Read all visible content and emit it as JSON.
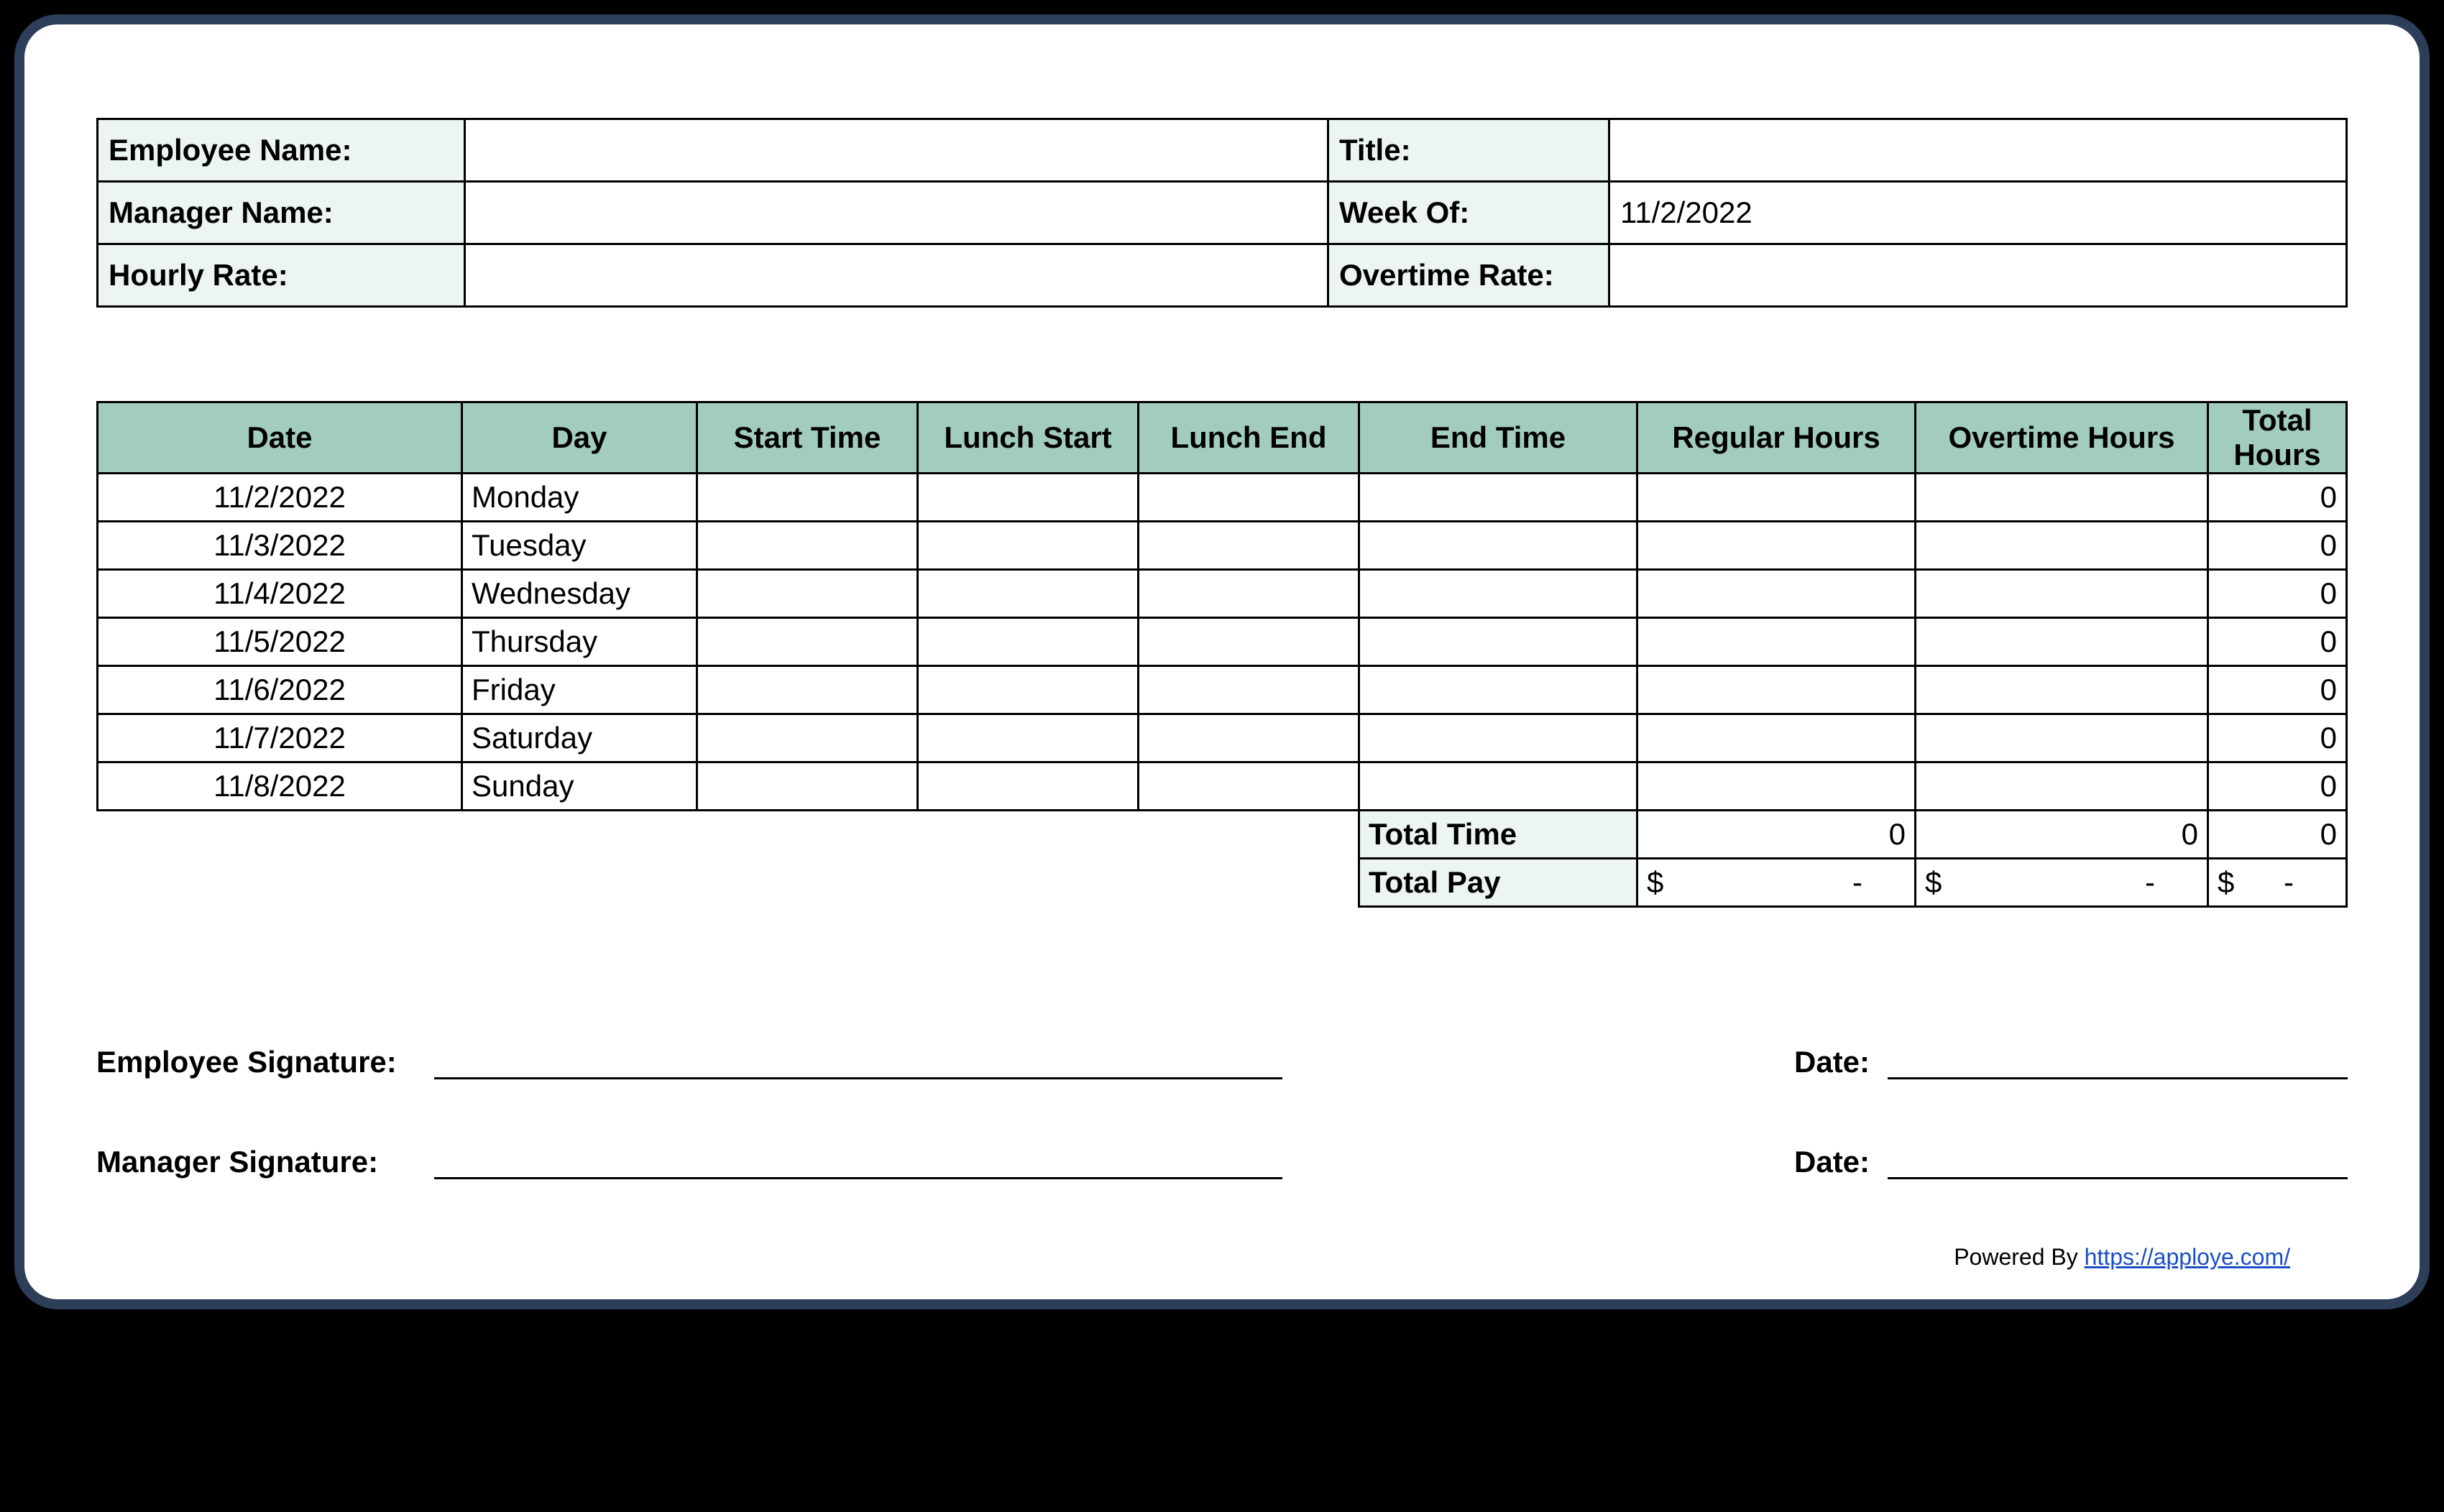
{
  "info": {
    "employee_name_label": "Employee Name:",
    "employee_name_value": "",
    "title_label": "Title:",
    "title_value": "",
    "manager_name_label": "Manager Name:",
    "manager_name_value": "",
    "week_of_label": "Week Of:",
    "week_of_value": "11/2/2022",
    "hourly_rate_label": "Hourly Rate:",
    "hourly_rate_value": "",
    "overtime_rate_label": "Overtime Rate:",
    "overtime_rate_value": ""
  },
  "headers": {
    "date": "Date",
    "day": "Day",
    "start_time": "Start Time",
    "lunch_start": "Lunch Start",
    "lunch_end": "Lunch End",
    "end_time": "End Time",
    "regular_hours": "Regular Hours",
    "overtime_hours": "Overtime Hours",
    "total_hours": "Total Hours"
  },
  "rows": [
    {
      "date": "11/2/2022",
      "day": "Monday",
      "start": "",
      "lstart": "",
      "lend": "",
      "end": "",
      "reg": "",
      "ot": "",
      "total": "0"
    },
    {
      "date": "11/3/2022",
      "day": "Tuesday",
      "start": "",
      "lstart": "",
      "lend": "",
      "end": "",
      "reg": "",
      "ot": "",
      "total": "0"
    },
    {
      "date": "11/4/2022",
      "day": "Wednesday",
      "start": "",
      "lstart": "",
      "lend": "",
      "end": "",
      "reg": "",
      "ot": "",
      "total": "0"
    },
    {
      "date": "11/5/2022",
      "day": "Thursday",
      "start": "",
      "lstart": "",
      "lend": "",
      "end": "",
      "reg": "",
      "ot": "",
      "total": "0"
    },
    {
      "date": "11/6/2022",
      "day": "Friday",
      "start": "",
      "lstart": "",
      "lend": "",
      "end": "",
      "reg": "",
      "ot": "",
      "total": "0"
    },
    {
      "date": "11/7/2022",
      "day": "Saturday",
      "start": "",
      "lstart": "",
      "lend": "",
      "end": "",
      "reg": "",
      "ot": "",
      "total": "0"
    },
    {
      "date": "11/8/2022",
      "day": "Sunday",
      "start": "",
      "lstart": "",
      "lend": "",
      "end": "",
      "reg": "",
      "ot": "",
      "total": "0"
    }
  ],
  "summary": {
    "total_time_label": "Total Time",
    "total_time_reg": "0",
    "total_time_ot": "0",
    "total_time_total": "0",
    "total_pay_label": "Total Pay",
    "pay_currency": "$",
    "pay_reg": "-",
    "pay_ot": "-",
    "pay_total": "-"
  },
  "signatures": {
    "employee_label": "Employee Signature:",
    "manager_label": "Manager Signature:",
    "date_label": "Date:"
  },
  "footer": {
    "powered_by": "Powered By ",
    "link_text": "https://apploye.com/"
  }
}
